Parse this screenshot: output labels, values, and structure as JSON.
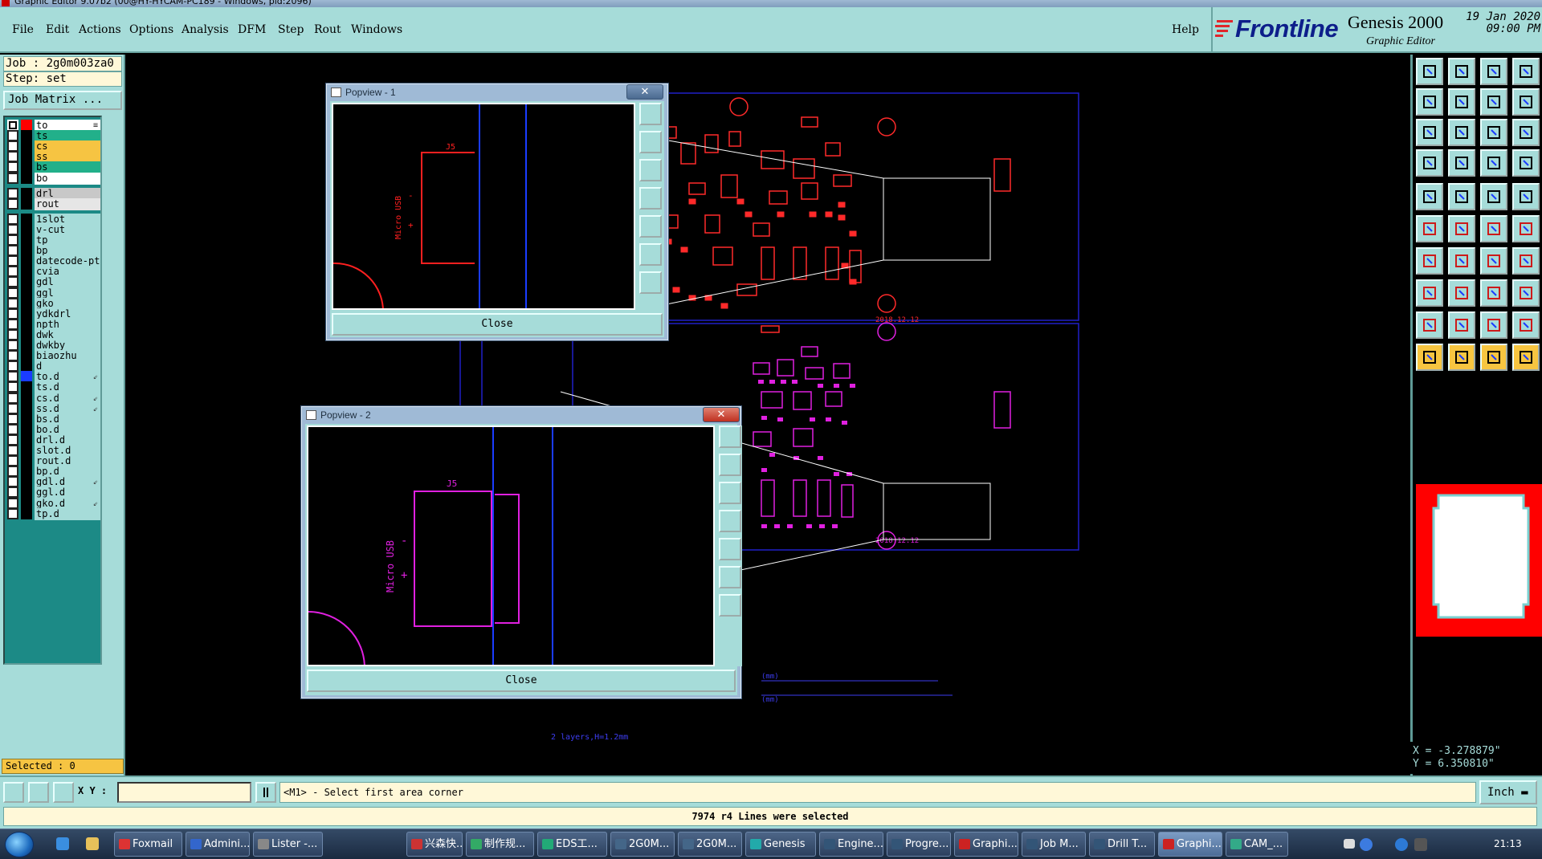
{
  "window": {
    "title": "Graphic Editor 9.07b2 (00@HY-HYCAM-PC189 - Windows, pid:2096)"
  },
  "menu": {
    "items": [
      "File",
      "Edit",
      "Actions",
      "Options",
      "Analysis",
      "DFM",
      "Step",
      "Rout",
      "Windows"
    ],
    "help": "Help"
  },
  "brand": {
    "logo": "Frontline",
    "product": "Genesis 2000",
    "subtitle": "Graphic Editor",
    "date": "19 Jan 2020",
    "time": "09:00 PM"
  },
  "job": {
    "job_line": "Job : 2g0m003za0",
    "step_line": "Step: set",
    "matrix_button": "Job Matrix ..."
  },
  "layers": [
    {
      "name": "to",
      "color": "#ffffff",
      "swatch": "#ff0000",
      "on": true,
      "mark": "≡"
    },
    {
      "name": "ts",
      "color": "#22b08a",
      "swatch": "#000000",
      "on": false,
      "mark": ""
    },
    {
      "name": "cs",
      "color": "#f6c442",
      "swatch": "#000000",
      "on": false,
      "mark": ""
    },
    {
      "name": "ss",
      "color": "#f6c442",
      "swatch": "#000000",
      "on": false,
      "mark": ""
    },
    {
      "name": "bs",
      "color": "#22b08a",
      "swatch": "#000000",
      "on": false,
      "mark": ""
    },
    {
      "name": "bo",
      "color": "#ffffff",
      "swatch": "#000000",
      "on": false,
      "mark": ""
    },
    {
      "name": "drl",
      "color": "#c8c8c8",
      "swatch": "#000000",
      "on": false,
      "mark": ""
    },
    {
      "name": "rout",
      "color": "#e6e6e6",
      "swatch": "#000000",
      "on": false,
      "mark": ""
    },
    {
      "name": "1slot",
      "color": "#a6dcd9",
      "swatch": "#000000",
      "on": false,
      "mark": ""
    },
    {
      "name": "v-cut",
      "color": "#a6dcd9",
      "swatch": "#000000",
      "on": false,
      "mark": ""
    },
    {
      "name": "tp",
      "color": "#a6dcd9",
      "swatch": "#000000",
      "on": false,
      "mark": ""
    },
    {
      "name": "bp",
      "color": "#a6dcd9",
      "swatch": "#000000",
      "on": false,
      "mark": ""
    },
    {
      "name": "datecode-pt",
      "color": "#a6dcd9",
      "swatch": "#000000",
      "on": false,
      "mark": ""
    },
    {
      "name": "cvia",
      "color": "#a6dcd9",
      "swatch": "#000000",
      "on": false,
      "mark": ""
    },
    {
      "name": "gdl",
      "color": "#a6dcd9",
      "swatch": "#000000",
      "on": false,
      "mark": ""
    },
    {
      "name": "ggl",
      "color": "#a6dcd9",
      "swatch": "#000000",
      "on": false,
      "mark": ""
    },
    {
      "name": "gko",
      "color": "#a6dcd9",
      "swatch": "#000000",
      "on": false,
      "mark": ""
    },
    {
      "name": "ydkdrl",
      "color": "#a6dcd9",
      "swatch": "#000000",
      "on": false,
      "mark": ""
    },
    {
      "name": "npth",
      "color": "#a6dcd9",
      "swatch": "#000000",
      "on": false,
      "mark": ""
    },
    {
      "name": "dwk",
      "color": "#a6dcd9",
      "swatch": "#000000",
      "on": false,
      "mark": ""
    },
    {
      "name": "dwkby",
      "color": "#a6dcd9",
      "swatch": "#000000",
      "on": false,
      "mark": ""
    },
    {
      "name": "biaozhu",
      "color": "#a6dcd9",
      "swatch": "#000000",
      "on": false,
      "mark": ""
    },
    {
      "name": "d",
      "color": "#a6dcd9",
      "swatch": "#000000",
      "on": false,
      "mark": ""
    },
    {
      "name": "to.d",
      "color": "#a6dcd9",
      "swatch": "#1a3cff",
      "on": false,
      "mark": "⇙"
    },
    {
      "name": "ts.d",
      "color": "#a6dcd9",
      "swatch": "#000000",
      "on": false,
      "mark": ""
    },
    {
      "name": "cs.d",
      "color": "#a6dcd9",
      "swatch": "#000000",
      "on": false,
      "mark": "⇙"
    },
    {
      "name": "ss.d",
      "color": "#a6dcd9",
      "swatch": "#000000",
      "on": false,
      "mark": "⇙"
    },
    {
      "name": "bs.d",
      "color": "#a6dcd9",
      "swatch": "#000000",
      "on": false,
      "mark": ""
    },
    {
      "name": "bo.d",
      "color": "#a6dcd9",
      "swatch": "#000000",
      "on": false,
      "mark": ""
    },
    {
      "name": "drl.d",
      "color": "#a6dcd9",
      "swatch": "#000000",
      "on": false,
      "mark": ""
    },
    {
      "name": "slot.d",
      "color": "#a6dcd9",
      "swatch": "#000000",
      "on": false,
      "mark": ""
    },
    {
      "name": "rout.d",
      "color": "#a6dcd9",
      "swatch": "#000000",
      "on": false,
      "mark": ""
    },
    {
      "name": "bp.d",
      "color": "#a6dcd9",
      "swatch": "#000000",
      "on": false,
      "mark": ""
    },
    {
      "name": "gdl.d",
      "color": "#a6dcd9",
      "swatch": "#000000",
      "on": false,
      "mark": "⇙"
    },
    {
      "name": "ggl.d",
      "color": "#a6dcd9",
      "swatch": "#000000",
      "on": false,
      "mark": ""
    },
    {
      "name": "gko.d",
      "color": "#a6dcd9",
      "swatch": "#000000",
      "on": false,
      "mark": "⇙"
    },
    {
      "name": "tp.d",
      "color": "#a6dcd9",
      "swatch": "#000000",
      "on": false,
      "mark": ""
    }
  ],
  "selected": "Selected : 0",
  "popviews": [
    {
      "title": "Popview - 1",
      "close": "Close",
      "label": "J5",
      "text": "Micro USB"
    },
    {
      "title": "Popview - 2",
      "close": "Close",
      "label": "J5",
      "text": "Micro USB"
    }
  ],
  "canvas_text": {
    "bottom_note": "2 layers,H=1.2mm",
    "pcb_label_1": "2018.12.12",
    "pcb_label_2": "2018.12.12",
    "mm_1": "(mm)",
    "mm_2": "(mm)"
  },
  "coords": {
    "x": "X = -3.278879\"",
    "y": "Y =  6.350810\""
  },
  "cmd": {
    "xy_label": "X Y :",
    "xy_value": "",
    "prompt": "<M1> - Select first area corner",
    "units": "Inch"
  },
  "status": "7974 r4 Lines were selected",
  "taskbar": {
    "tasks": [
      "Foxmail",
      "Admini...",
      "Lister -...",
      "兴森快...",
      "制作规...",
      "EDS工...",
      "2G0M...",
      "2G0M...",
      "Genesis",
      "Engine...",
      "Progre...",
      "Graphi...",
      "Job M...",
      "Drill T...",
      "Graphi...",
      "CAM_..."
    ],
    "clock": "21:13"
  },
  "colors": {
    "panel": "#a6dcd9",
    "selected_bg": "#f6c442",
    "pcb_top": "#ff2a2a",
    "pcb_bottom": "#e020e0",
    "outline": "#2020ff"
  }
}
